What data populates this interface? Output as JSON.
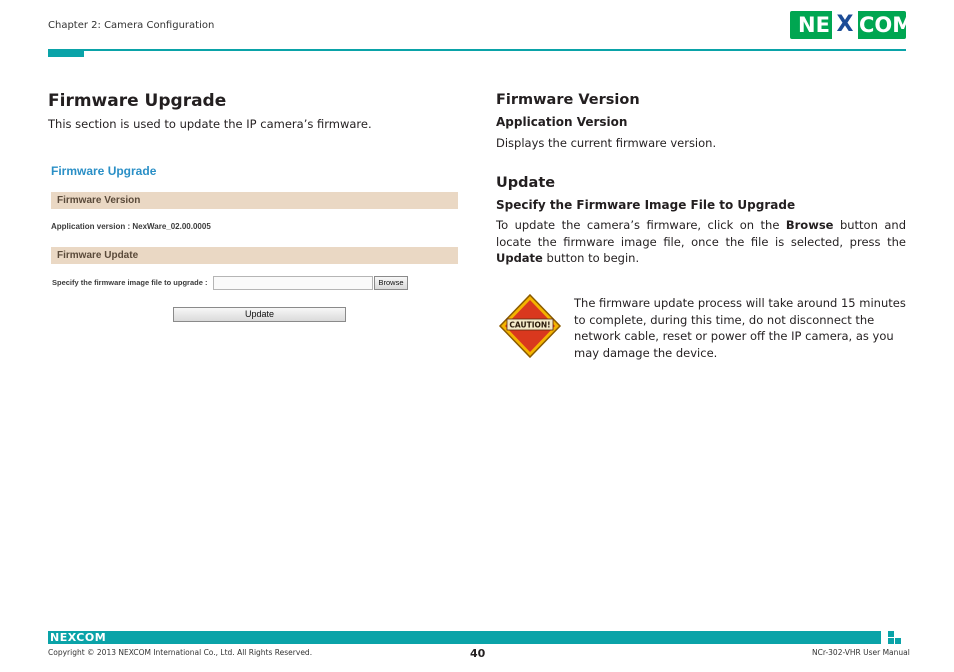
{
  "header": {
    "chapter": "Chapter 2: Camera Configuration",
    "logo": "NEXCOM",
    "logo_left": "NE",
    "logo_x": "X",
    "logo_right": "COM"
  },
  "left": {
    "heading": "Firmware Upgrade",
    "intro": "This section is used to update the IP camera’s firmware.",
    "screenshot": {
      "title": "Firmware Upgrade",
      "section_version": "Firmware Version",
      "app_version": "Application version : NexWare_02.00.0005",
      "section_update": "Firmware Update",
      "specify_label": "Specify the firmware image file to upgrade :",
      "browse_label": "Browse",
      "update_label": "Update"
    }
  },
  "right": {
    "fw_version_heading": "Firmware Version",
    "app_version_heading": "Application Version",
    "app_version_text": "Displays the current firmware version.",
    "update_heading": "Update",
    "specify_heading": "Specify the Firmware Image File to Upgrade",
    "update_text_1": "To update the camera’s firmware, click on the ",
    "update_text_browse": "Browse",
    "update_text_2": " button and locate the firmware image file, once the file is selected, press the ",
    "update_text_update": "Update",
    "update_text_3": " button to begin.",
    "caution_label": "CAUTION!",
    "caution_text": "The firmware update process will take around 15 minutes to complete, during this time, do not disconnect the network cable, reset or power off the IP camera, as you may damage the device."
  },
  "footer": {
    "logo": "NEXCOM",
    "copyright": "Copyright © 2013 NEXCOM International Co., Ltd. All Rights Reserved.",
    "page": "40",
    "manual": "NCr-302-VHR User Manual"
  },
  "colors": {
    "teal": "#0aa3a8",
    "logo_green": "#00a651",
    "screenshot_title_blue": "#2a8fc6",
    "section_bar": "#ead8c4"
  }
}
